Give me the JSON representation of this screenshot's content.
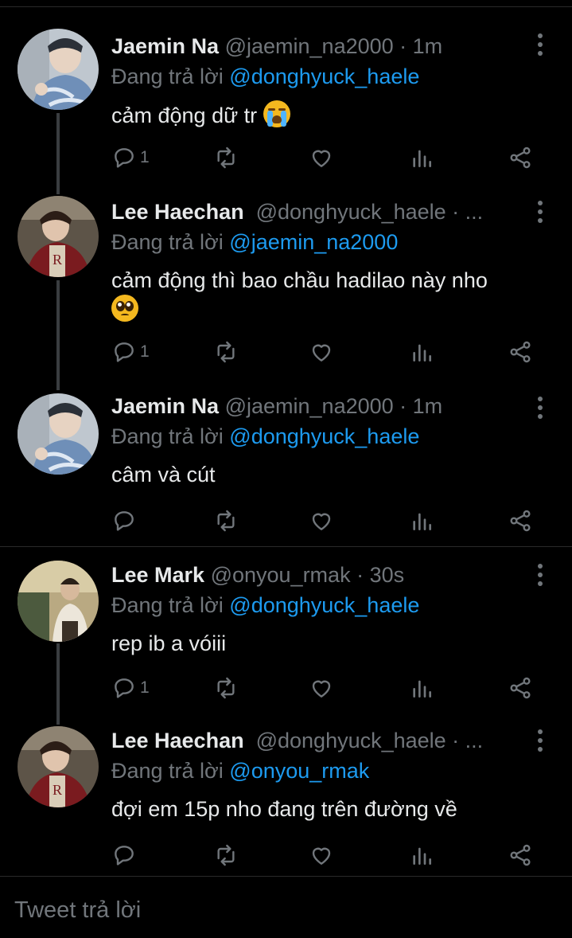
{
  "tweets": [
    {
      "name": "Jaemin Na",
      "handle": "@jaemin_na2000",
      "time": "· 1m",
      "reply_prefix": "Đang trả lời",
      "reply_to": "@donghyuck_haele",
      "text": "cảm động dữ tr",
      "emoji": "loudly-crying-face",
      "reply_count": "1",
      "avatar_colors": [
        "#cfd6dc",
        "#6f8fb8",
        "#2f3a48"
      ]
    },
    {
      "name": "Lee Haechan",
      "handle": "@donghyuck_haele · ...",
      "time": "",
      "reply_prefix": "Đang trả lời",
      "reply_to": "@jaemin_na2000",
      "text": "cảm động thì bao chầu hadilao này nho",
      "emoji": "pleading-face",
      "reply_count": "1",
      "avatar_colors": [
        "#6e5d4b",
        "#8a1f22",
        "#2a2220"
      ]
    },
    {
      "name": "Jaemin Na",
      "handle": "@jaemin_na2000",
      "time": "· 1m",
      "reply_prefix": "Đang trả lời",
      "reply_to": "@donghyuck_haele",
      "text": "câm và cút",
      "emoji": "",
      "reply_count": "",
      "avatar_colors": [
        "#cfd6dc",
        "#6f8fb8",
        "#2f3a48"
      ]
    },
    {
      "name": "Lee Mark",
      "handle": "@onyou_rmak",
      "time": "· 30s",
      "reply_prefix": "Đang trả lời",
      "reply_to": "@donghyuck_haele",
      "text": "rep ib a vóiii",
      "emoji": "",
      "reply_count": "1",
      "avatar_colors": [
        "#c9b98a",
        "#e8e2d4",
        "#5a4a36"
      ]
    },
    {
      "name": "Lee Haechan",
      "handle": "@donghyuck_haele · ...",
      "time": "",
      "reply_prefix": "Đang trả lời",
      "reply_to": "@onyou_rmak",
      "text": "đợi em 15p nho đang trên đường về",
      "emoji": "",
      "reply_count": "",
      "avatar_colors": [
        "#6e5d4b",
        "#8a1f22",
        "#2a2220"
      ]
    }
  ],
  "composer": {
    "placeholder": "Tweet trả lời"
  },
  "colors": {
    "background": "#000000",
    "text": "#e7e9ea",
    "muted": "#71767b",
    "link": "#1d9bf0",
    "thread_line": "#3a3d40"
  },
  "icons": {
    "reply": "reply-icon",
    "retweet": "retweet-icon",
    "like": "heart-icon",
    "views": "views-icon",
    "share": "share-icon",
    "more": "more-vertical-icon"
  }
}
